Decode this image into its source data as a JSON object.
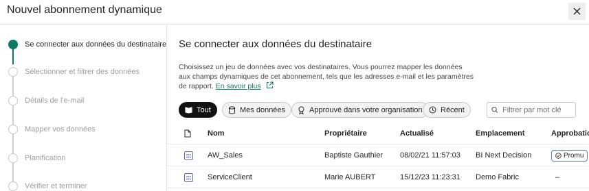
{
  "dialog": {
    "title": "Nouvel abonnement dynamique"
  },
  "steps": [
    {
      "label": "Se connecter aux données du destinataire",
      "active": true
    },
    {
      "label": "Sélectionner et filtrer des données",
      "active": false
    },
    {
      "label": "Détails de l'e-mail",
      "active": false
    },
    {
      "label": "Mapper vos données",
      "active": false
    },
    {
      "label": "Planification",
      "active": false
    },
    {
      "label": "Vérifier et terminer",
      "active": false
    }
  ],
  "main": {
    "title": "Se connecter aux données du destinataire",
    "description": "Choisissez un jeu de données avec vos destinataires. Vous pourrez mapper les données aux champs dynamiques de cet abonnement, tels que les adresses e-mail et les paramètres de rapport.",
    "learn_more": "En savoir plus"
  },
  "filters": {
    "all": "Tout",
    "my_data": "Mes données",
    "endorsed": "Approuvé dans votre organisation",
    "recent": "Récent",
    "search_placeholder": "Filtrer par mot clé"
  },
  "table": {
    "headers": {
      "name": "Nom",
      "owner": "Propriétaire",
      "refreshed": "Actualisé",
      "location": "Emplacement",
      "endorsement": "Approbation"
    },
    "rows": [
      {
        "name": "AW_Sales",
        "owner": "Baptiste Gauthier",
        "refreshed": "08/02/21 11:57:03",
        "location": "BI Next Decision",
        "endorsement": "Promu"
      },
      {
        "name": "ServiceClient",
        "owner": "Marie AUBERT",
        "refreshed": "15/12/23 11:23:31",
        "location": "Demo Fabric",
        "endorsement": "–"
      }
    ]
  },
  "colors": {
    "accent": "#117865",
    "badge_border": "#5a7fd6",
    "chip_selected": "#111111"
  }
}
